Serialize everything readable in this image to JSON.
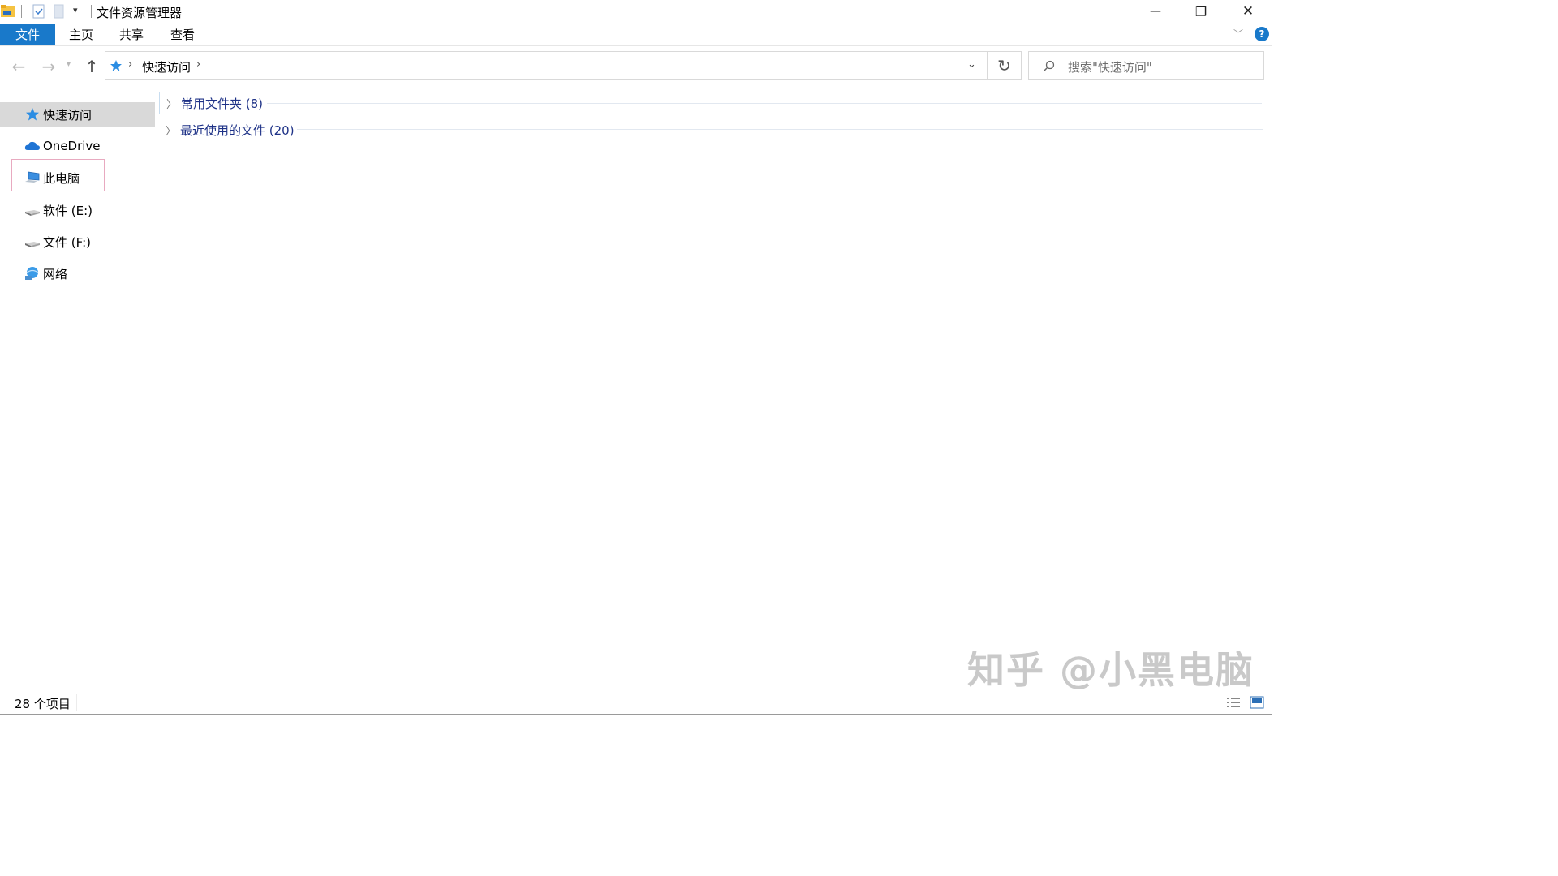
{
  "window": {
    "title": "文件资源管理器",
    "minimize_glyph": "—",
    "restore_glyph": "❐",
    "close_glyph": "✕"
  },
  "ribbon": {
    "tabs": [
      {
        "label": "文件",
        "active": true
      },
      {
        "label": "主页"
      },
      {
        "label": "共享"
      },
      {
        "label": "查看"
      }
    ],
    "help_glyph": "?",
    "accent": "#1979ca"
  },
  "nav": {
    "back_glyph": "←",
    "forward_glyph": "→",
    "up_glyph": "↑",
    "refresh_glyph": "↻",
    "breadcrumb": [
      "快速访问"
    ],
    "search_placeholder": "搜索\"快速访问\""
  },
  "sidebar": {
    "items": [
      {
        "label": "快速访问",
        "icon": "star-icon",
        "selected": true
      },
      {
        "label": "OneDrive",
        "icon": "cloud-icon"
      },
      {
        "label": "此电脑",
        "icon": "computer-icon",
        "highlighted": true
      },
      {
        "label": "软件 (E:)",
        "icon": "drive-icon"
      },
      {
        "label": "文件 (F:)",
        "icon": "drive-icon"
      },
      {
        "label": "网络",
        "icon": "network-icon"
      }
    ]
  },
  "content": {
    "groups": [
      {
        "label": "常用文件夹 (8)"
      },
      {
        "label": "最近使用的文件 (20)"
      }
    ]
  },
  "status": {
    "item_count": "28 个项目"
  },
  "watermark": "知乎 @小黑电脑"
}
